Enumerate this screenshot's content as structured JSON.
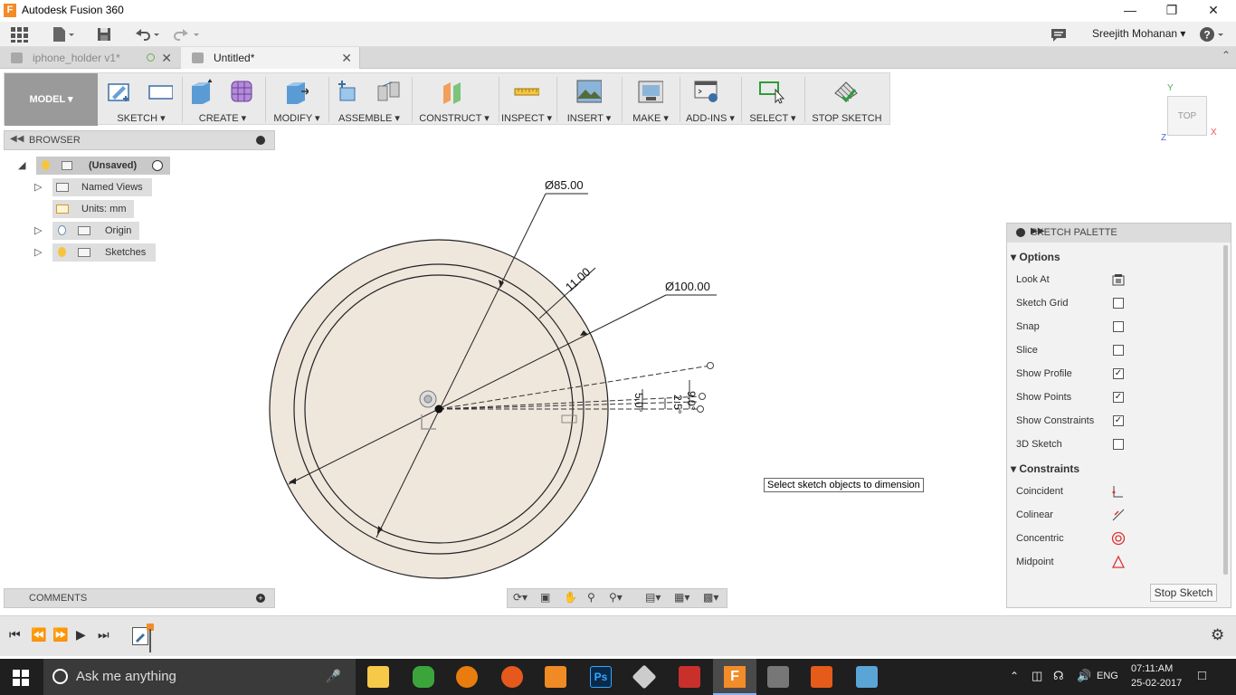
{
  "window": {
    "title": "Autodesk Fusion 360",
    "icon_letter": "F"
  },
  "qabar": {
    "user": "Sreejith Mohanan ▾",
    "help": "?"
  },
  "tabs": [
    {
      "label": "iphone_holder v1*"
    },
    {
      "label": "Untitled*"
    }
  ],
  "ribbon": {
    "model": "MODEL ▾",
    "groups": [
      "SKETCH ▾",
      "CREATE ▾",
      "MODIFY ▾",
      "ASSEMBLE ▾",
      "CONSTRUCT ▾",
      "INSPECT ▾",
      "INSERT ▾",
      "MAKE ▾",
      "ADD-INS ▾",
      "SELECT ▾",
      "STOP SKETCH"
    ]
  },
  "viewcube": {
    "face": "TOP",
    "axis_x": "X",
    "axis_y": "Y",
    "axis_z": "Z"
  },
  "browser": {
    "title": "BROWSER",
    "root": "(Unsaved)",
    "items": [
      "Named Views",
      "Units: mm",
      "Origin",
      "Sketches"
    ]
  },
  "comments": {
    "title": "COMMENTS"
  },
  "sketch": {
    "dim_85": "Ø85.00",
    "dim_100": "Ø100.00",
    "dim_11": "11.00",
    "angle_90": "9.0°",
    "angle_50": "5.0°",
    "angle_25": "2.5°"
  },
  "tooltip": "Select sketch objects to dimension",
  "palette": {
    "title": "SKETCH PALETTE",
    "options_title": "Options",
    "options": [
      {
        "label": "Look At",
        "type": "icon"
      },
      {
        "label": "Sketch Grid",
        "checked": false
      },
      {
        "label": "Snap",
        "checked": false
      },
      {
        "label": "Slice",
        "checked": false
      },
      {
        "label": "Show Profile",
        "checked": true
      },
      {
        "label": "Show Points",
        "checked": true
      },
      {
        "label": "Show Constraints",
        "checked": true
      },
      {
        "label": "3D Sketch",
        "checked": false
      }
    ],
    "constraints_title": "Constraints",
    "constraints": [
      "Coincident",
      "Colinear",
      "Concentric",
      "Midpoint"
    ],
    "stop_button": "Stop Sketch"
  },
  "taskbar": {
    "search": "Ask me anything",
    "lang": "ENG",
    "time": "07:11:AM",
    "date": "25-02-2017"
  }
}
